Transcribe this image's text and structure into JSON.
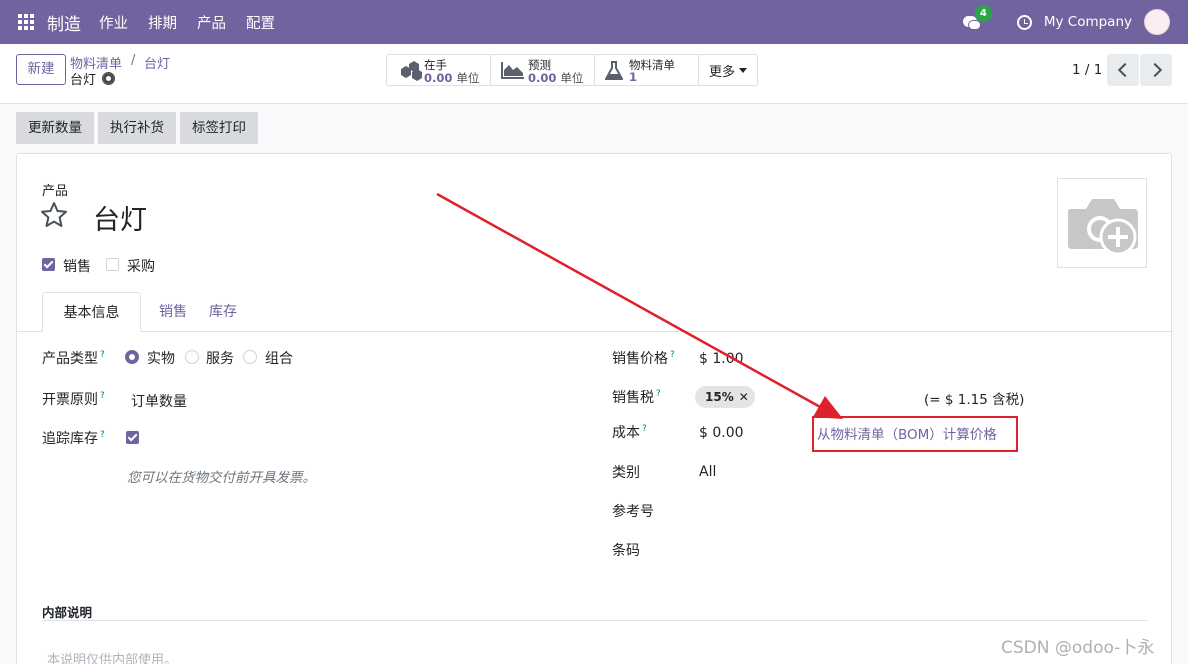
{
  "nav": {
    "app_name": "制造",
    "menu": [
      "作业",
      "排期",
      "产品",
      "配置"
    ],
    "chat_badge": "4",
    "company": "My Company"
  },
  "control": {
    "new_label": "新建",
    "breadcrumb_parent": "物料清单",
    "breadcrumb_sep": "/",
    "breadcrumb_current": "台灯",
    "record_name": "台灯",
    "smart_buttons": [
      {
        "label": "在手",
        "value": "0.00",
        "unit": "单位"
      },
      {
        "label": "预测",
        "value": "0.00",
        "unit": "单位"
      },
      {
        "label": "物料清单",
        "value": "1"
      }
    ],
    "more_label": "更多",
    "pager": "1 / 1"
  },
  "actions": [
    "更新数量",
    "执行补货",
    "标签打印"
  ],
  "product": {
    "section_label": "产品",
    "name": "台灯",
    "sale_ok_label": "销售",
    "purchase_ok_label": "采购",
    "tabs": [
      "基本信息",
      "销售",
      "库存"
    ],
    "fields": {
      "type_label": "产品类型",
      "type_options": [
        "实物",
        "服务",
        "组合"
      ],
      "invoice_policy_label": "开票原则",
      "invoice_policy_value": "订单数量",
      "track_inventory_label": "追踪库存",
      "invoice_hint": "您可以在货物交付前开具发票。",
      "list_price_label": "销售价格",
      "list_price_value": "$ 1.00",
      "taxes_label": "销售税",
      "tax_tag": "15%",
      "tax_included": "(= $ 1.15 含税)",
      "cost_label": "成本",
      "cost_value": "$ 0.00",
      "bom_cost_link": "从物料清单（BOM）计算价格",
      "category_label": "类别",
      "category_value": "All",
      "reference_label": "参考号",
      "barcode_label": "条码"
    },
    "internal_notes_label": "内部说明",
    "internal_notes_placeholder": "本说明仅供内部使用。",
    "help_mark": "?"
  },
  "watermark": "CSDN @odoo-卜永",
  "colors": {
    "brand": "#71639e",
    "annotation": "#e0202a",
    "badge": "#28a745"
  }
}
